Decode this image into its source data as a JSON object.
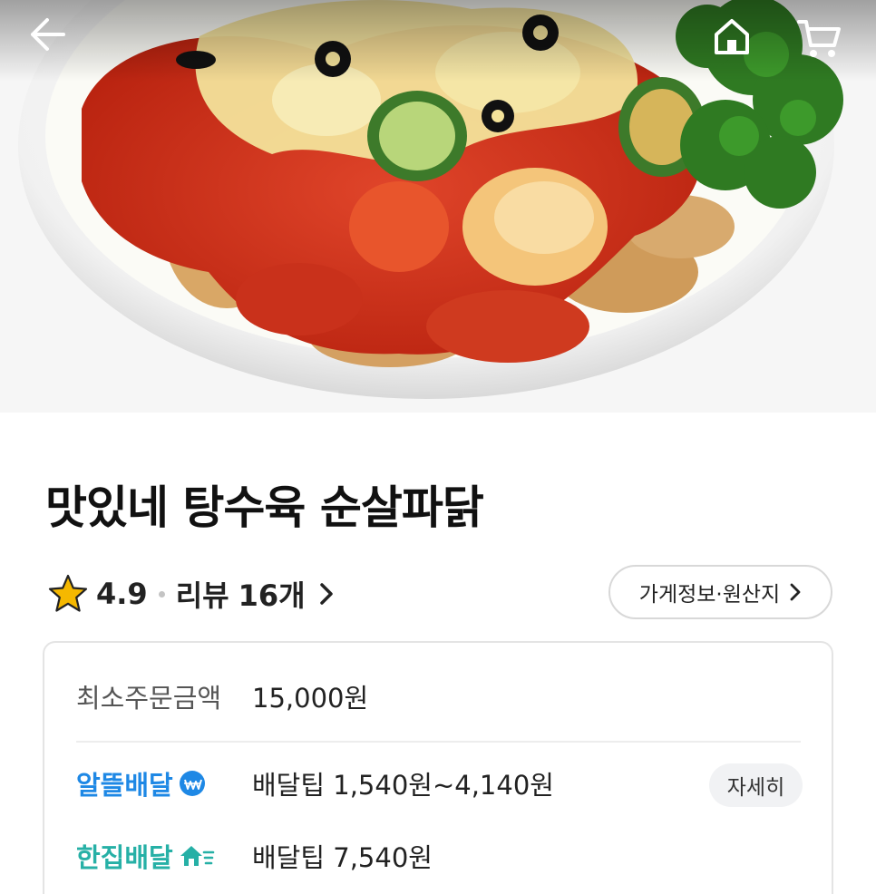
{
  "header": {
    "back_icon": "arrow-left-icon",
    "home_icon": "home-icon",
    "cart_icon": "cart-icon"
  },
  "store": {
    "title": "맛있네 탕수육 순살파닭",
    "rating": "4.9",
    "review_label": "리뷰",
    "review_count": "16개",
    "info_button": "가게정보·원산지"
  },
  "info_card": {
    "min_order_label": "최소주문금액",
    "min_order_value": "15,000원",
    "eco_delivery": {
      "name": "알뜰배달",
      "tip": "배달팁 1,540원~4,140원",
      "detail_label": "자세히",
      "color": "#1e88e5"
    },
    "single_delivery": {
      "name": "한집배달",
      "tip": "배달팁 7,540원",
      "color": "#26b0a6"
    }
  },
  "colors": {
    "star": "#f5b800",
    "border": "#e4e4e4"
  }
}
